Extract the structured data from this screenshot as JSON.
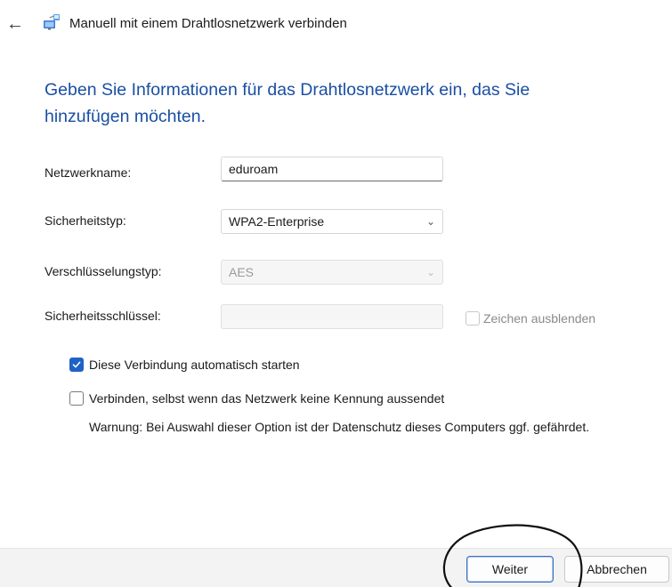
{
  "window": {
    "title": "Manuell mit einem Drahtlosnetzwerk verbinden",
    "back_icon": "back-arrow-icon",
    "app_icon": "wireless-network-icon"
  },
  "heading": "Geben Sie Informationen für das Drahtlosnetzwerk ein, das Sie hinzufügen möchten.",
  "form": {
    "network_name": {
      "label": "Netzwerkname:",
      "value": "eduroam"
    },
    "security_type": {
      "label": "Sicherheitstyp:",
      "selected": "WPA2-Enterprise"
    },
    "encryption_type": {
      "label": "Verschlüsselungstyp:",
      "selected": "AES"
    },
    "security_key": {
      "label": "Sicherheitsschlüssel:",
      "value": "",
      "hide_chars_label": "Zeichen ausblenden",
      "hide_chars_checked": false
    }
  },
  "options": {
    "auto_start": {
      "label": "Diese Verbindung automatisch starten",
      "checked": true
    },
    "connect_hidden": {
      "label": "Verbinden, selbst wenn das Netzwerk keine Kennung aussendet",
      "checked": false
    },
    "warning": "Warnung: Bei Auswahl dieser Option ist der Datenschutz dieses Computers ggf. gefährdet."
  },
  "footer": {
    "next_label": "Weiter",
    "cancel_label": "Abbrechen"
  },
  "colors": {
    "heading": "#1a4fa3",
    "accent": "#1f62c6",
    "footer_bg": "#f3f3f3"
  }
}
